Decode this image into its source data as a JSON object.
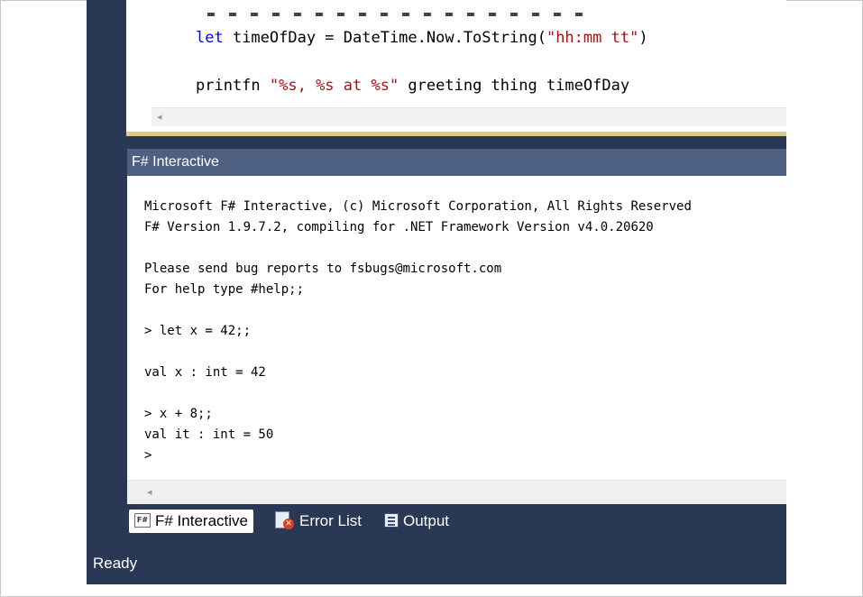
{
  "editor": {
    "line1": {
      "keyword": "let",
      "before_str": " timeOfDay = DateTime.Now.ToString(",
      "string": "\"hh:mm tt\"",
      "after_str": ")"
    },
    "line2": {
      "before_str": "printfn ",
      "string": "\"%s, %s at %s\"",
      "after_str": " greeting thing timeOfDay"
    },
    "scroll_left_icon": "left-arrow"
  },
  "fsi": {
    "title": "F# Interactive",
    "output": "Microsoft F# Interactive, (c) Microsoft Corporation, All Rights Reserved\nF# Version 1.9.7.2, compiling for .NET Framework Version v4.0.20620\n\nPlease send bug reports to fsbugs@microsoft.com\nFor help type #help;;\n\n> let x = 42;;\n\nval x : int = 42\n\n> x + 8;;\nval it : int = 50\n>",
    "scroll_left_icon": "left-arrow"
  },
  "tabs": [
    {
      "label": "F# Interactive",
      "icon": "fsharp-file-icon",
      "active": true
    },
    {
      "label": "Error List",
      "icon": "error-list-icon",
      "active": false
    },
    {
      "label": "Output",
      "icon": "output-icon",
      "active": false
    }
  ],
  "status": {
    "text": "Ready"
  },
  "colors": {
    "ide_background": "#293955",
    "panel_title": "#4d6082",
    "keyword": "#0000ff",
    "string": "#a31515"
  }
}
